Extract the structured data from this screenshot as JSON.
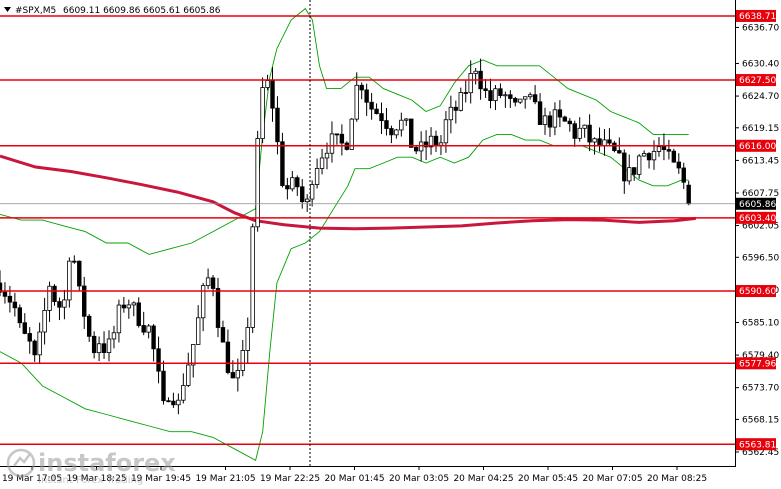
{
  "header": {
    "symbol": "#SPX,M5",
    "ohlc": "6609.11 6609.86 6605.61 6605.86",
    "open": 6609.11,
    "high": 6609.86,
    "low": 6605.61,
    "close": 6605.86
  },
  "colors": {
    "background": "#ffffff",
    "candles": "#000000",
    "levels": "#e8000b",
    "ma": "#c8163c",
    "bands": "#00a000",
    "price_line": "#8b8b8b",
    "price_tag_bg": "#000000",
    "price_tag_text": "#ffffff"
  },
  "watermark": {
    "brand": "instaforex",
    "tagline": "Instant Forex Trading",
    "icon": "instaforex-logo-icon"
  },
  "chart_data": {
    "type": "candlestick",
    "instrument": "#SPX",
    "timeframe": "M5",
    "ylim": [
      6560.0,
      6641.5
    ],
    "y_ticks": [
      "6636.70",
      "6630.40",
      "6624.70",
      "6619.15",
      "6613.45",
      "6607.75",
      "6602.05",
      "6596.50",
      "6590.80",
      "6585.10",
      "6579.40",
      "6573.70",
      "6568.15",
      "6562.45"
    ],
    "x_ticks": [
      "19 Mar 17:05",
      "19 Mar 18:25",
      "19 Mar 19:45",
      "19 Mar 21:05",
      "19 Mar 22:25",
      "20 Mar 01:45",
      "20 Mar 03:05",
      "20 Mar 04:25",
      "20 Mar 05:45",
      "20 Mar 07:05",
      "20 Mar 08:25"
    ],
    "levels": [
      {
        "value": 6638.71,
        "label": "6638.71"
      },
      {
        "value": 6627.5,
        "label": "6627.50"
      },
      {
        "value": 6616.0,
        "label": "6616.00"
      },
      {
        "value": 6603.4,
        "label": "6603.40"
      },
      {
        "value": 6590.6,
        "label": "6590.60"
      },
      {
        "value": 6577.96,
        "label": "6577.96"
      },
      {
        "value": 6563.81,
        "label": "6563.81"
      }
    ],
    "current_price": {
      "value": 6605.86,
      "label": "6605.86"
    },
    "session_separator_x": "19 Mar 22:25",
    "ma_path": [
      [
        0,
        6614.2
      ],
      [
        0.05,
        6612.3
      ],
      [
        0.1,
        6611.5
      ],
      [
        0.15,
        6610.4
      ],
      [
        0.2,
        6609.2
      ],
      [
        0.25,
        6607.9
      ],
      [
        0.3,
        6606.2
      ],
      [
        0.33,
        6604.3
      ],
      [
        0.36,
        6602.9
      ],
      [
        0.4,
        6602.2
      ],
      [
        0.45,
        6601.6
      ],
      [
        0.5,
        6601.5
      ],
      [
        0.55,
        6601.6
      ],
      [
        0.6,
        6601.8
      ],
      [
        0.65,
        6602.0
      ],
      [
        0.7,
        6602.5
      ],
      [
        0.75,
        6602.9
      ],
      [
        0.8,
        6603.1
      ],
      [
        0.85,
        6603.0
      ],
      [
        0.9,
        6602.6
      ],
      [
        0.95,
        6602.9
      ],
      [
        0.98,
        6603.3
      ]
    ],
    "bands_upper": [
      [
        0,
        6604
      ],
      [
        0.03,
        6603
      ],
      [
        0.06,
        6603
      ],
      [
        0.09,
        6602
      ],
      [
        0.12,
        6601
      ],
      [
        0.15,
        6599
      ],
      [
        0.18,
        6599
      ],
      [
        0.21,
        6597
      ],
      [
        0.24,
        6598
      ],
      [
        0.27,
        6599
      ],
      [
        0.3,
        6601
      ],
      [
        0.33,
        6603
      ],
      [
        0.36,
        6605
      ],
      [
        0.37,
        6618
      ],
      [
        0.38,
        6628
      ],
      [
        0.39,
        6633
      ],
      [
        0.41,
        6638
      ],
      [
        0.43,
        6640
      ],
      [
        0.44,
        6638
      ],
      [
        0.45,
        6630
      ],
      [
        0.46,
        6626
      ],
      [
        0.48,
        6626
      ],
      [
        0.5,
        6628
      ],
      [
        0.52,
        6628
      ],
      [
        0.54,
        6626
      ],
      [
        0.56,
        6625
      ],
      [
        0.58,
        6624
      ],
      [
        0.6,
        6622
      ],
      [
        0.62,
        6623
      ],
      [
        0.64,
        6627
      ],
      [
        0.66,
        6630
      ],
      [
        0.68,
        6631
      ],
      [
        0.7,
        6630
      ],
      [
        0.72,
        6630
      ],
      [
        0.74,
        6630
      ],
      [
        0.76,
        6630
      ],
      [
        0.78,
        6628
      ],
      [
        0.8,
        6626
      ],
      [
        0.82,
        6625
      ],
      [
        0.84,
        6624
      ],
      [
        0.86,
        6622
      ],
      [
        0.88,
        6621
      ],
      [
        0.9,
        6620
      ],
      [
        0.92,
        6618
      ],
      [
        0.94,
        6618
      ],
      [
        0.96,
        6618
      ],
      [
        0.97,
        6618
      ]
    ],
    "bands_lower": [
      [
        0,
        6580
      ],
      [
        0.03,
        6578
      ],
      [
        0.06,
        6574
      ],
      [
        0.09,
        6572
      ],
      [
        0.12,
        6570
      ],
      [
        0.15,
        6569
      ],
      [
        0.18,
        6568
      ],
      [
        0.21,
        6567
      ],
      [
        0.24,
        6566
      ],
      [
        0.27,
        6566
      ],
      [
        0.3,
        6565
      ],
      [
        0.33,
        6563
      ],
      [
        0.36,
        6561
      ],
      [
        0.37,
        6566
      ],
      [
        0.38,
        6580
      ],
      [
        0.39,
        6592
      ],
      [
        0.41,
        6598
      ],
      [
        0.43,
        6599
      ],
      [
        0.45,
        6601
      ],
      [
        0.47,
        6605
      ],
      [
        0.49,
        6609
      ],
      [
        0.5,
        6612
      ],
      [
        0.52,
        6612
      ],
      [
        0.54,
        6613
      ],
      [
        0.56,
        6614
      ],
      [
        0.58,
        6614
      ],
      [
        0.6,
        6613
      ],
      [
        0.62,
        6614
      ],
      [
        0.64,
        6613
      ],
      [
        0.66,
        6614
      ],
      [
        0.68,
        6617
      ],
      [
        0.7,
        6618
      ],
      [
        0.72,
        6618
      ],
      [
        0.74,
        6617
      ],
      [
        0.76,
        6617
      ],
      [
        0.78,
        6616
      ],
      [
        0.8,
        6616
      ],
      [
        0.82,
        6616
      ],
      [
        0.84,
        6615
      ],
      [
        0.86,
        6614
      ],
      [
        0.88,
        6612
      ],
      [
        0.9,
        6610
      ],
      [
        0.92,
        6609
      ],
      [
        0.94,
        6609
      ],
      [
        0.96,
        6610
      ],
      [
        0.97,
        6610
      ]
    ],
    "close_path": [
      [
        0,
        6592
      ],
      [
        0.02,
        6588
      ],
      [
        0.03,
        6583
      ],
      [
        0.04,
        6582
      ],
      [
        0.05,
        6578
      ],
      [
        0.06,
        6585
      ],
      [
        0.07,
        6592
      ],
      [
        0.08,
        6588
      ],
      [
        0.09,
        6588
      ],
      [
        0.1,
        6600
      ],
      [
        0.11,
        6591
      ],
      [
        0.12,
        6586
      ],
      [
        0.13,
        6580
      ],
      [
        0.14,
        6582
      ],
      [
        0.15,
        6580
      ],
      [
        0.16,
        6583
      ],
      [
        0.17,
        6588
      ],
      [
        0.18,
        6589
      ],
      [
        0.19,
        6587
      ],
      [
        0.2,
        6585
      ],
      [
        0.21,
        6584
      ],
      [
        0.22,
        6578
      ],
      [
        0.23,
        6570
      ],
      [
        0.24,
        6574
      ],
      [
        0.25,
        6570
      ],
      [
        0.26,
        6576
      ],
      [
        0.27,
        6580
      ],
      [
        0.28,
        6586
      ],
      [
        0.29,
        6593
      ],
      [
        0.3,
        6592
      ],
      [
        0.31,
        6583
      ],
      [
        0.32,
        6578
      ],
      [
        0.33,
        6574
      ],
      [
        0.34,
        6577
      ],
      [
        0.35,
        6586
      ],
      [
        0.355,
        6600
      ],
      [
        0.36,
        6612
      ],
      [
        0.37,
        6626
      ],
      [
        0.38,
        6627
      ],
      [
        0.39,
        6617
      ],
      [
        0.4,
        6608
      ],
      [
        0.41,
        6609
      ],
      [
        0.42,
        6609
      ],
      [
        0.43,
        6604
      ],
      [
        0.44,
        6611
      ],
      [
        0.45,
        6614
      ],
      [
        0.46,
        6616
      ],
      [
        0.47,
        6617
      ],
      [
        0.48,
        6616
      ],
      [
        0.49,
        6617
      ],
      [
        0.5,
        6626
      ],
      [
        0.51,
        6627
      ],
      [
        0.52,
        6623
      ],
      [
        0.53,
        6622
      ],
      [
        0.54,
        6621
      ],
      [
        0.55,
        6619
      ],
      [
        0.56,
        6620
      ],
      [
        0.57,
        6620
      ],
      [
        0.58,
        6616
      ],
      [
        0.59,
        6615
      ],
      [
        0.6,
        6616
      ],
      [
        0.61,
        6617
      ],
      [
        0.62,
        6616
      ],
      [
        0.63,
        6621
      ],
      [
        0.64,
        6622
      ],
      [
        0.65,
        6624
      ],
      [
        0.66,
        6627
      ],
      [
        0.67,
        6630
      ],
      [
        0.68,
        6626
      ],
      [
        0.69,
        6624
      ],
      [
        0.7,
        6625
      ],
      [
        0.71,
        6625
      ],
      [
        0.72,
        6623
      ],
      [
        0.73,
        6622
      ],
      [
        0.74,
        6625
      ],
      [
        0.75,
        6623
      ],
      [
        0.76,
        6621
      ],
      [
        0.77,
        6620
      ],
      [
        0.78,
        6621
      ],
      [
        0.79,
        6620
      ],
      [
        0.8,
        6620
      ],
      [
        0.81,
        6618
      ],
      [
        0.82,
        6619
      ],
      [
        0.83,
        6617
      ],
      [
        0.84,
        6616
      ],
      [
        0.85,
        6616
      ],
      [
        0.86,
        6615
      ],
      [
        0.87,
        6614
      ],
      [
        0.88,
        6611
      ],
      [
        0.89,
        6611
      ],
      [
        0.9,
        6614
      ],
      [
        0.91,
        6615
      ],
      [
        0.92,
        6615
      ],
      [
        0.93,
        6616
      ],
      [
        0.94,
        6614
      ],
      [
        0.95,
        6612
      ],
      [
        0.96,
        6611
      ],
      [
        0.97,
        6606
      ]
    ]
  }
}
